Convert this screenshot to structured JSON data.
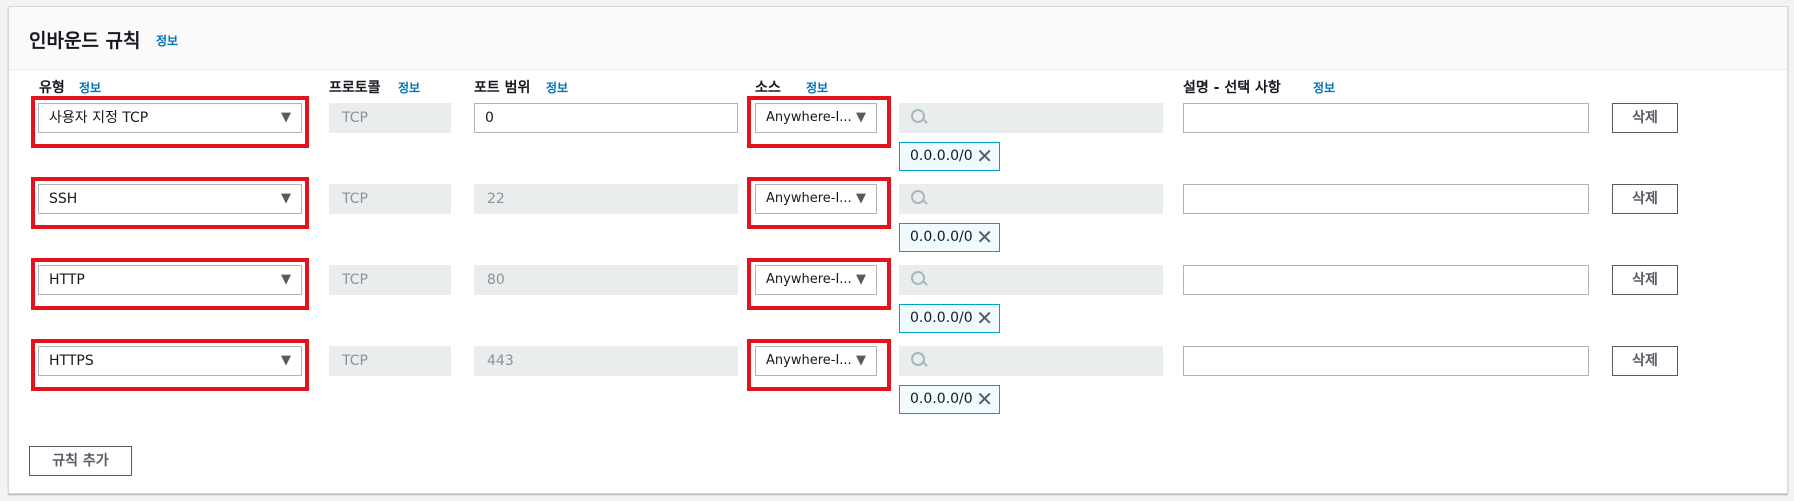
{
  "header": {
    "title": "인바운드 규칙",
    "info": "정보"
  },
  "columns": {
    "type": "유형",
    "protocol": "프로토콜",
    "port_range": "포트 범위",
    "source": "소스",
    "description": "설명 - 선택 사항",
    "info": "정보"
  },
  "rules": [
    {
      "type": "사용자 지정 TCP",
      "protocol": "TCP",
      "port": "0",
      "source": "Anywhere-I...",
      "cidr": "0.0.0.0/0",
      "description": "",
      "delete": "삭제"
    },
    {
      "type": "SSH",
      "protocol": "TCP",
      "port": "22",
      "source": "Anywhere-I...",
      "cidr": "0.0.0.0/0",
      "description": "",
      "delete": "삭제"
    },
    {
      "type": "HTTP",
      "protocol": "TCP",
      "port": "80",
      "source": "Anywhere-I...",
      "cidr": "0.0.0.0/0",
      "description": "",
      "delete": "삭제"
    },
    {
      "type": "HTTPS",
      "protocol": "TCP",
      "port": "443",
      "source": "Anywhere-I...",
      "cidr": "0.0.0.0/0",
      "description": "",
      "delete": "삭제"
    }
  ],
  "actions": {
    "add_rule": "규칙 추가"
  },
  "colors": {
    "highlight": "#e3121c",
    "link": "#0073bb",
    "token_border": "#00a1c9"
  },
  "icons": {
    "dropdown": "caret-down-icon",
    "search": "search-icon",
    "remove": "close-icon"
  }
}
